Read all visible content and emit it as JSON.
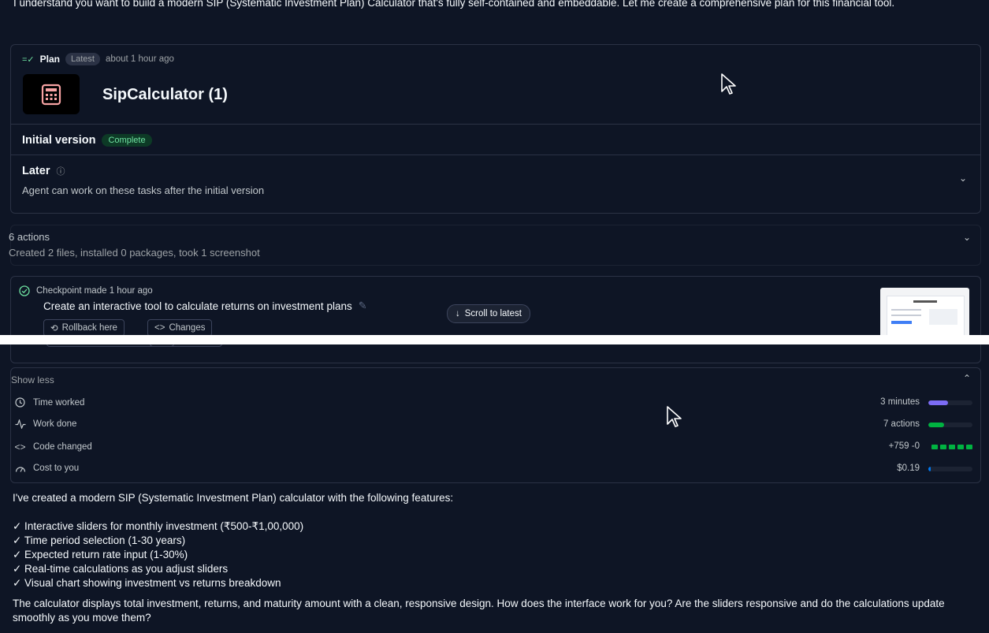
{
  "intro_text": "I understand you want to build a modern SIP (Systematic Investment Plan) Calculator that's fully self-contained and embeddable. Let me create a comprehensive plan for this financial tool.",
  "plan": {
    "label": "Plan",
    "badge": "Latest",
    "time": "about 1 hour ago",
    "app_title": "SipCalculator (1)",
    "initial_version": "Initial version",
    "status": "Complete",
    "later_title": "Later",
    "later_desc": "Agent can work on these tasks after the initial version"
  },
  "actions": {
    "count": "6 actions",
    "summary": "Created 2 files, installed 0 packages, took 1 screenshot"
  },
  "checkpoint": {
    "made": "Checkpoint made 1 hour ago",
    "description": "Create an interactive tool to calculate returns on investment plans",
    "rollback": "Rollback here",
    "changes": "Changes"
  },
  "scroll_pill": "Scroll to latest",
  "stats": {
    "toggle": "Show less",
    "rows": [
      {
        "label": "Time worked",
        "value": "3 minutes",
        "icon": "clock-icon",
        "fill": 0.45,
        "color": "#7c6cf5"
      },
      {
        "label": "Work done",
        "value": "7 actions",
        "icon": "activity-icon",
        "fill": 0.35,
        "color": "#00b341"
      },
      {
        "label": "Code changed",
        "value": "+759 -0",
        "icon": "code-icon"
      },
      {
        "label": "Cost to you",
        "value": "$0.19",
        "icon": "gauge-icon",
        "fill": 0.06,
        "color": "#0079f2"
      }
    ]
  },
  "reply": {
    "lead": "I've created a modern SIP (Systematic Investment Plan) calculator with the following features:",
    "features": [
      "✓ Interactive sliders for monthly investment (₹500-₹1,00,000)",
      "✓ Time period selection (1-30 years)",
      "✓ Expected return rate input (1-30%)",
      "✓ Real-time calculations as you adjust sliders",
      "✓ Visual chart showing investment vs returns breakdown"
    ],
    "closing": "The calculator displays total investment, returns, and maturity amount with a clean, responsive design. How does the interface work for you? Are the sliders responsive and do the calculations update smoothly as you move them?"
  }
}
